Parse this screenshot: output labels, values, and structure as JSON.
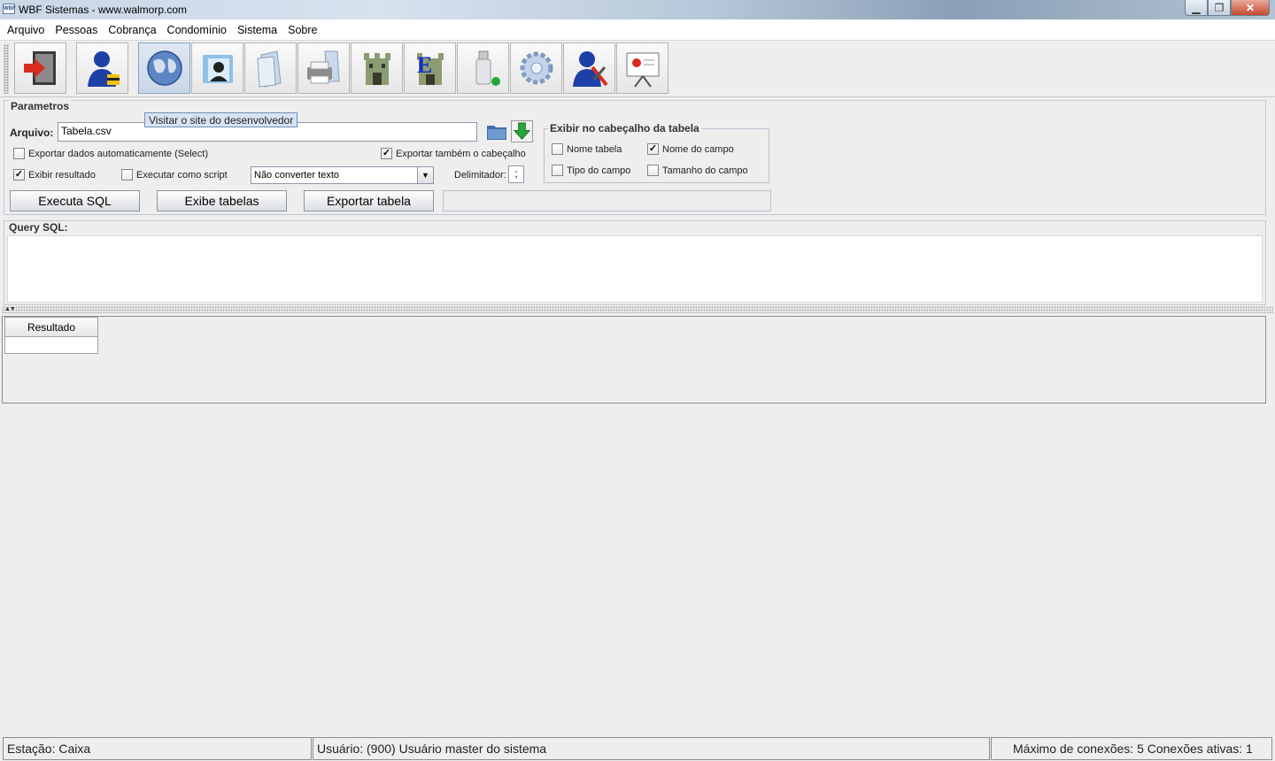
{
  "window": {
    "title": "WBF Sistemas - www.walmorp.com",
    "app_icon_text": "WBF"
  },
  "menu": [
    {
      "label": "Arquivo"
    },
    {
      "label": "Pessoas"
    },
    {
      "label": "Cobrança"
    },
    {
      "label": "Condomínio"
    },
    {
      "label": "Sistema"
    },
    {
      "label": "Sobre"
    }
  ],
  "toolbar": {
    "buttons": [
      {
        "icon": "exit-icon"
      },
      {
        "icon": "user-lock-icon"
      },
      {
        "icon": "globe-icon"
      },
      {
        "icon": "contact-folder-icon"
      },
      {
        "icon": "documents-icon"
      },
      {
        "icon": "printer-icon"
      },
      {
        "icon": "castle-icon"
      },
      {
        "icon": "castle-e-icon"
      },
      {
        "icon": "usb-drive-icon"
      },
      {
        "icon": "gear-icon"
      },
      {
        "icon": "user-tools-icon"
      },
      {
        "icon": "presentation-icon"
      }
    ],
    "tooltip": "Visitar o site do desenvolvedor"
  },
  "params": {
    "legend": "Parametros",
    "file_label": "Arquivo:",
    "file_value": "Tabela.csv",
    "export_auto_label": "Exportar dados automaticamente (Select)",
    "export_auto_checked": false,
    "export_header_label": "Exportar também o cabeçalho",
    "export_header_checked": true,
    "show_result_label": "Exibir resultado",
    "show_result_checked": true,
    "run_script_label": "Executar como script",
    "run_script_checked": false,
    "convert_selected": "Não converter texto",
    "delimiter_label": "Delimitador:",
    "delimiter_value": ";",
    "execute_button": "Executa SQL",
    "show_tables_button": "Exibe tabelas",
    "export_table_button": "Exportar tabela",
    "header_group": {
      "legend": "Exibir no cabeçalho da tabela",
      "table_name_label": "Nome tabela",
      "table_name_checked": false,
      "field_name_label": "Nome do campo",
      "field_name_checked": true,
      "field_type_label": "Tipo do campo",
      "field_type_checked": false,
      "field_size_label": "Tamanho do campo",
      "field_size_checked": false
    }
  },
  "query": {
    "legend": "Query SQL:",
    "text": ""
  },
  "results": {
    "header": "Resultado"
  },
  "status": {
    "station": "Estação: Caixa",
    "user": "Usuário: (900) Usuário master do sistema",
    "connections": "Máximo de conexões: 5 Conexões ativas: 1"
  },
  "colors": {
    "accent": "#7f9bc0",
    "tooltip_bg": "#d7e3f2"
  }
}
